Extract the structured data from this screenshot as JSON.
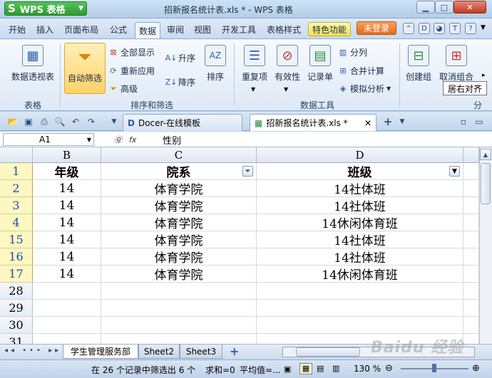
{
  "titlebar": {
    "app_button": "WPS 表格",
    "app_logo": "S",
    "title": "招新报名统计表.xls * - WPS 表格"
  },
  "menu": {
    "tabs": [
      "开始",
      "插入",
      "页面布局",
      "公式",
      "数据",
      "审阅",
      "视图",
      "开发工具",
      "表格样式",
      "特色功能"
    ],
    "active_tab": "数据",
    "login": "未登录"
  },
  "ribbon": {
    "pivot": "数据透视表",
    "autofilter": "自动筛选",
    "show_all": "全部显示",
    "reapply": "重新应用",
    "advanced": "高级",
    "asc": "升序",
    "desc": "降序",
    "sort": "排序",
    "duplicates": "重复项",
    "validation": "有效性",
    "record": "记录单",
    "split": "分列",
    "consolidate": "合并计算",
    "simulate": "模拟分析",
    "group": "创建组",
    "ungroup": "取消组合",
    "group_labels": {
      "table": "表格",
      "sort_filter": "排序和筛选",
      "data_tools": "数据工具",
      "outline": "分"
    },
    "tooltip": "居右对齐"
  },
  "doc_tabs": [
    {
      "label": "Docer-在线模板"
    },
    {
      "label": "招新报名统计表.xls *"
    }
  ],
  "formula_bar": {
    "cell_ref": "A1",
    "value": "性别"
  },
  "grid": {
    "columns": [
      "B",
      "C",
      "D"
    ],
    "rows": [
      {
        "num": "1",
        "cells": [
          "年级",
          "院系",
          "班级"
        ],
        "header": true
      },
      {
        "num": "2",
        "cells": [
          "14",
          "体育学院",
          "14社体班"
        ]
      },
      {
        "num": "3",
        "cells": [
          "14",
          "体育学院",
          "14社体班"
        ]
      },
      {
        "num": "4",
        "cells": [
          "14",
          "体育学院",
          "14休闲体育班"
        ]
      },
      {
        "num": "15",
        "cells": [
          "14",
          "体育学院",
          "14社体班"
        ]
      },
      {
        "num": "16",
        "cells": [
          "14",
          "体育学院",
          "14社体班"
        ]
      },
      {
        "num": "17",
        "cells": [
          "14",
          "体育学院",
          "14休闲体育班"
        ]
      },
      {
        "num": "28",
        "cells": [
          "",
          "",
          ""
        ],
        "plain": true
      },
      {
        "num": "29",
        "cells": [
          "",
          "",
          ""
        ],
        "plain": true
      },
      {
        "num": "30",
        "cells": [
          "",
          "",
          ""
        ],
        "plain": true
      },
      {
        "num": "31",
        "cells": [
          "",
          "",
          ""
        ],
        "plain": true
      }
    ]
  },
  "sheets": [
    "学生管理服务部",
    "Sheet2",
    "Sheet3"
  ],
  "status": {
    "filter_info": "在 26 个记录中筛选出 6 个",
    "sum": "求和=0",
    "avg": "平均值=...",
    "zoom": "130 %"
  },
  "watermark": "Baidu 经验"
}
